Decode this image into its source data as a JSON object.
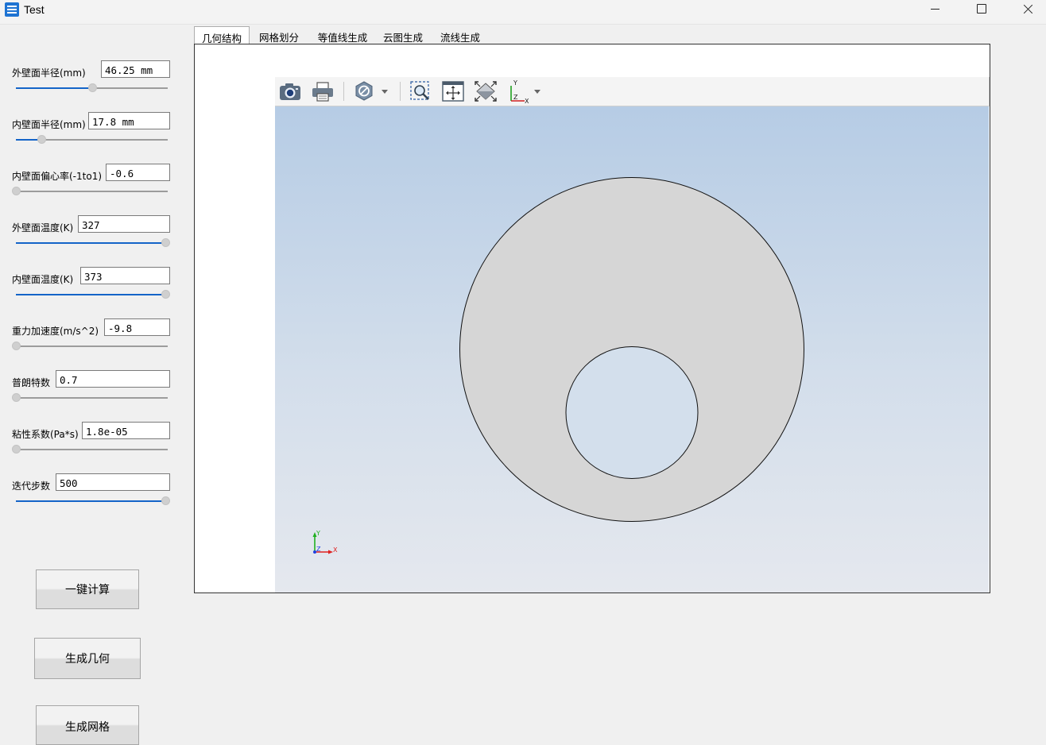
{
  "window": {
    "title": "Test"
  },
  "params": [
    {
      "label": "外壁面半径(mm)",
      "value": "46.25 mm",
      "level": 0.5
    },
    {
      "label": "内壁面半径(mm)",
      "value": "17.8 mm",
      "level": 0.17
    },
    {
      "label": "内壁面偏心率(-1to1)",
      "value": "-0.6",
      "level": 0.0
    },
    {
      "label": "外壁面温度(K)",
      "value": "327",
      "level": 1.0
    },
    {
      "label": "内壁面温度(K)",
      "value": "373",
      "level": 1.0
    },
    {
      "label": "重力加速度(m/s^2)",
      "value": "-9.8",
      "level": 0.0
    },
    {
      "label": "普朗特数",
      "value": "0.7",
      "level": 0.0
    },
    {
      "label": "粘性系数(Pa*s)",
      "value": "1.8e-05",
      "level": 0.0
    },
    {
      "label": "迭代步数",
      "value": "500",
      "level": 1.0
    }
  ],
  "buttons": {
    "compute": "一键计算",
    "geometry": "生成几何",
    "mesh": "生成网格"
  },
  "tabs": [
    "几何结构",
    "网格划分",
    "等值线生成",
    "云图生成",
    "流线生成"
  ],
  "active_tab": "几何结构",
  "toolbar": {
    "icons": [
      "camera-icon",
      "print-icon",
      "display-mode-icon",
      "zoom-box-icon",
      "pan-icon",
      "fit-all-icon",
      "axis-view-icon"
    ]
  },
  "axis_triad": {
    "x": "X",
    "y": "Y",
    "z": "Z"
  },
  "colors": {
    "slider_accent": "#1464c8",
    "shape_fill": "#d6d6d6",
    "axis_x": "#e02020",
    "axis_y": "#20b020",
    "axis_z": "#2040e0"
  }
}
